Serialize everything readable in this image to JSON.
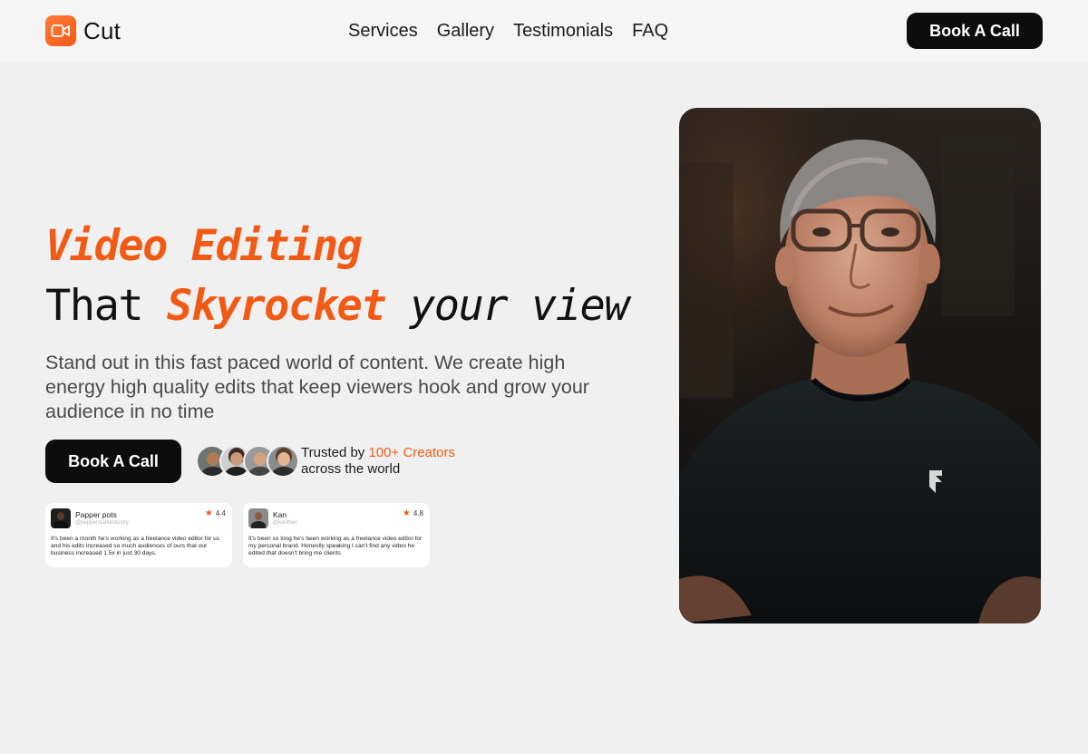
{
  "brand": {
    "name": "Cut",
    "icon": "video-camera-icon",
    "accent": "#f05a14"
  },
  "nav": {
    "items": [
      "Services",
      "Gallery",
      "Testimonials",
      "FAQ"
    ],
    "cta": "Book A Call"
  },
  "hero": {
    "title_line1": "Video Editing",
    "title_that": "That ",
    "title_accent": "Skyrocket",
    "title_rest": " your view",
    "subtitle": "Stand out in this fast paced world of content. We create high energy high quality edits that keep viewers hook and grow your audience in no time",
    "cta": "Book A Call",
    "trusted_prefix": "Trusted by ",
    "trusted_highlight": "100+ Creators",
    "trusted_suffix": "across the world"
  },
  "reviews": [
    {
      "name": "Papper pots",
      "handle": "@pepperstarkindustry",
      "rating": "4.4",
      "text": "It's been a month he's working as a freelance video editor for us and his edits increased so much audiences of ours that our business increased 1.5x in just 30 days."
    },
    {
      "name": "Kan",
      "handle": "@kanthec",
      "rating": "4.8",
      "text": "It's been so long he's been working as a freelance video editor for my personal brand. Honestly speaking I can't find any video he edited that doesn't bring me clients."
    }
  ]
}
